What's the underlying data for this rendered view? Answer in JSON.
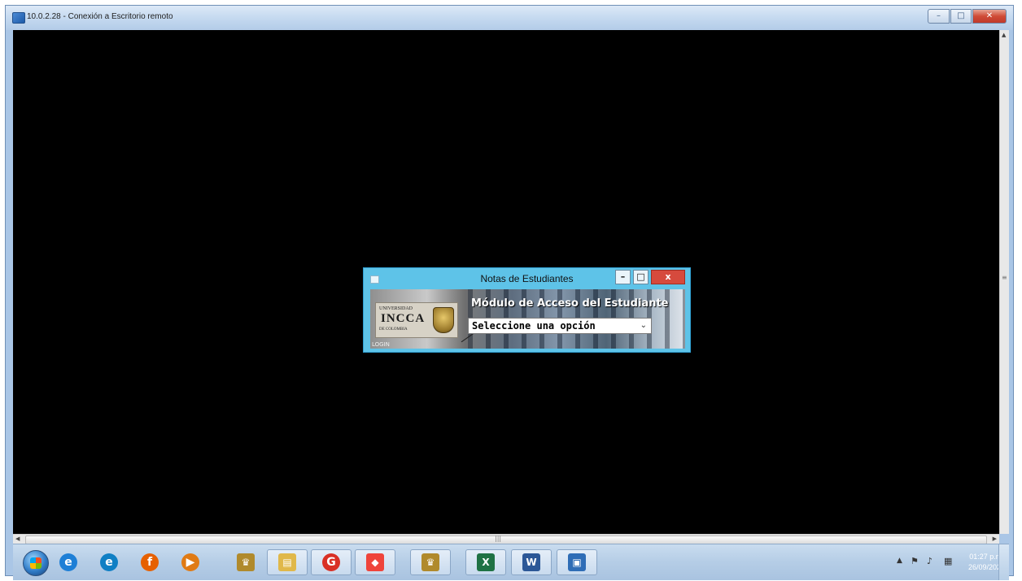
{
  "rdp_window": {
    "title": "10.0.2.28 - Conexión a Escritorio remoto",
    "buttons": {
      "minimize": "–",
      "maximize": "□",
      "close": "✕"
    }
  },
  "remote_app": {
    "title": "Notas de Estudiantes",
    "buttons": {
      "minimize": "–",
      "maximize": "□",
      "close": "x"
    },
    "heading": "Módulo de Acceso del Estudiante",
    "select": {
      "value": "Seleccione una opción"
    },
    "logo": {
      "top": "UNIVERSIDAD",
      "main": "INCCA",
      "bottom": "DE COLOMBIA"
    },
    "footer": "LOGIN"
  },
  "taskbar": {
    "items": [
      {
        "name": "internet-explorer",
        "glyph": "e",
        "color": "#1e7fd6"
      },
      {
        "name": "edge",
        "glyph": "e",
        "color": "#0f7fc4"
      },
      {
        "name": "firefox",
        "glyph": "f",
        "color": "#e66000"
      },
      {
        "name": "media",
        "glyph": "▶",
        "color": "#e07a14"
      },
      {
        "name": "incca-app-1",
        "glyph": "♛",
        "color": "#b08a2c"
      },
      {
        "name": "explorer",
        "glyph": "▤",
        "color": "#e0b84a"
      },
      {
        "name": "chrome",
        "glyph": "G",
        "color": "#d93025"
      },
      {
        "name": "anydesk",
        "glyph": "◆",
        "color": "#ef443b"
      },
      {
        "name": "incca-app-2",
        "glyph": "♛",
        "color": "#b08a2c"
      },
      {
        "name": "excel",
        "glyph": "X",
        "color": "#1f7244"
      },
      {
        "name": "word",
        "glyph": "W",
        "color": "#2b5797"
      },
      {
        "name": "remote-desktop",
        "glyph": "▣",
        "color": "#2f6db6"
      }
    ],
    "tray": {
      "time": "01:27 p.m.",
      "date": "26/09/2022"
    }
  },
  "colors": {
    "screen": "#000000",
    "app_border": "#5ec3e8",
    "close": "#d64a3d"
  }
}
